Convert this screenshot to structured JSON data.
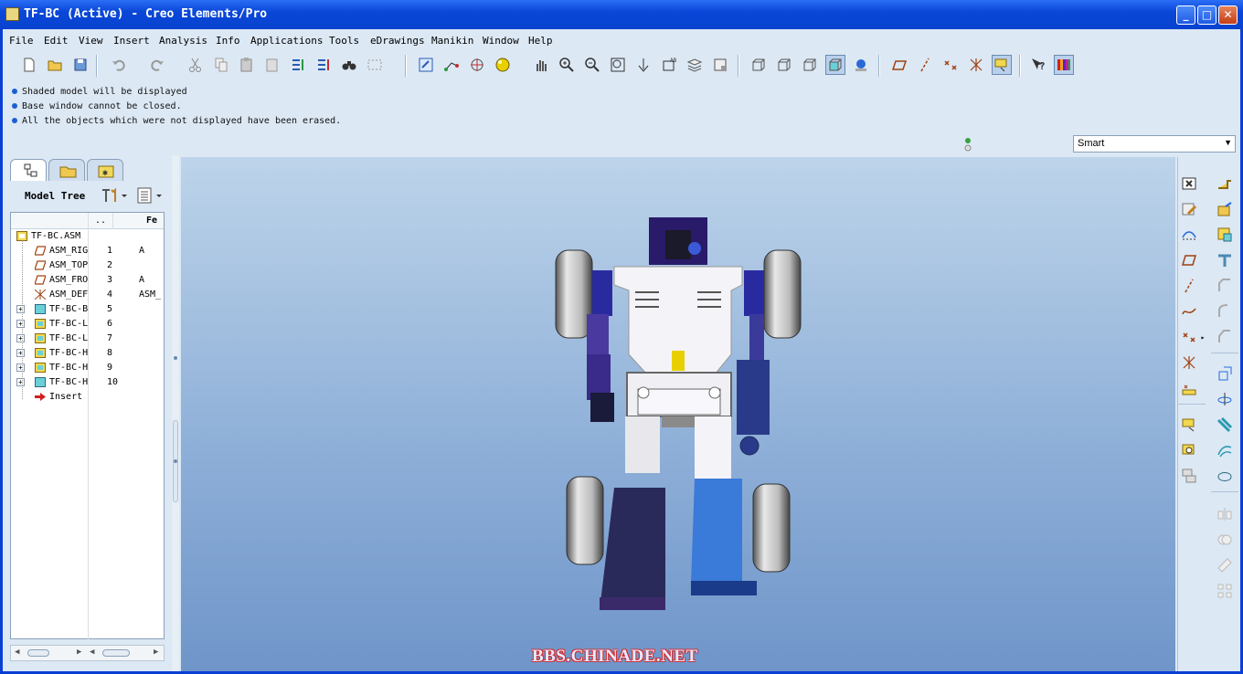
{
  "window": {
    "title": "TF-BC (Active) - Creo Elements/Pro",
    "minimize": "_",
    "maximize": "□",
    "close": "✕"
  },
  "menu": [
    "File",
    "Edit",
    "View",
    "Insert",
    "Analysis",
    "Info",
    "Applications",
    "Tools",
    "eDrawings",
    "Manikin",
    "Window",
    "Help"
  ],
  "messages": [
    "Shaded model will be displayed",
    "Base window cannot be closed.",
    "All the objects which were not displayed have been erased."
  ],
  "filter": {
    "value": "Smart",
    "arrow": "▼"
  },
  "panel": {
    "title": "Model Tree",
    "col_dots": "..",
    "col_feature": "Fe",
    "rows": [
      {
        "name": "TF-BC.ASM",
        "num": "",
        "feat": "",
        "type": "asm"
      },
      {
        "name": "ASM_RIGHT",
        "num": "1",
        "feat": "A",
        "type": "plane"
      },
      {
        "name": "ASM_TOP",
        "num": "2",
        "feat": "",
        "type": "plane"
      },
      {
        "name": "ASM_FRONT",
        "num": "3",
        "feat": "A",
        "type": "plane"
      },
      {
        "name": "ASM_DEF_CSYS",
        "num": "4",
        "feat": "ASM_",
        "type": "csys"
      },
      {
        "name": "TF-BC-B",
        "num": "5",
        "feat": "",
        "type": "part"
      },
      {
        "name": "TF-BC-L",
        "num": "6",
        "feat": "",
        "type": "subasm"
      },
      {
        "name": "TF-BC-L",
        "num": "7",
        "feat": "",
        "type": "subasm"
      },
      {
        "name": "TF-BC-H",
        "num": "8",
        "feat": "",
        "type": "subasm"
      },
      {
        "name": "TF-BC-H",
        "num": "9",
        "feat": "",
        "type": "subasm"
      },
      {
        "name": "TF-BC-H",
        "num": "10",
        "feat": "",
        "type": "part"
      },
      {
        "name": "Insert Here",
        "num": "",
        "feat": "",
        "type": "insert"
      }
    ]
  },
  "watermark": "BBS.CHINADE.NET"
}
